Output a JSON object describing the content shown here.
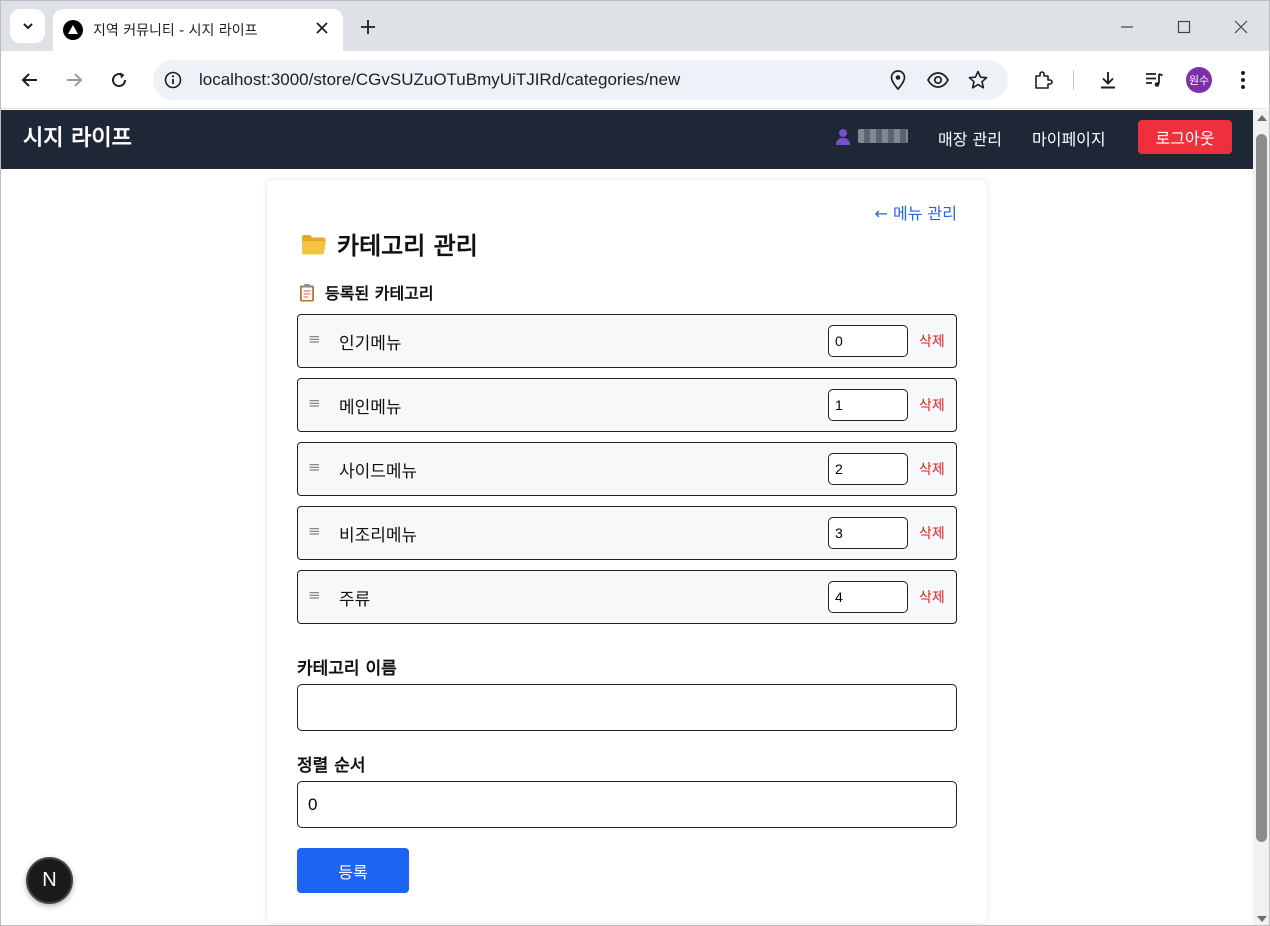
{
  "browser": {
    "tab_title": "지역 커뮤니티 - 시지 라이프",
    "url": "localhost:3000/store/CGvSUZuOTuBmyUiTJIRd/categories/new",
    "profile_label": "원수",
    "profile_color": "#7b2fa8"
  },
  "appbar": {
    "brand": "시지 라이프",
    "store_manage": "매장 관리",
    "mypage": "마이페이지",
    "logout": "로그아웃",
    "background": "#1e2735",
    "logout_color": "#ef2f3c"
  },
  "page": {
    "back_link": "← 메뉴 관리",
    "title": "카테고리 관리",
    "registered_title": "등록된 카테고리",
    "categories": [
      {
        "name": "인기메뉴",
        "order": "0",
        "delete": "삭제"
      },
      {
        "name": "메인메뉴",
        "order": "1",
        "delete": "삭제"
      },
      {
        "name": "사이드메뉴",
        "order": "2",
        "delete": "삭제"
      },
      {
        "name": "비조리메뉴",
        "order": "3",
        "delete": "삭제"
      },
      {
        "name": "주류",
        "order": "4",
        "delete": "삭제"
      }
    ],
    "form": {
      "name_label": "카테고리 이름",
      "name_value": "",
      "order_label": "정렬 순서",
      "order_value": "0",
      "submit_label": "등록"
    },
    "accent_color": "#1d64f2",
    "delete_color": "#e02424"
  },
  "dev_badge": "N"
}
